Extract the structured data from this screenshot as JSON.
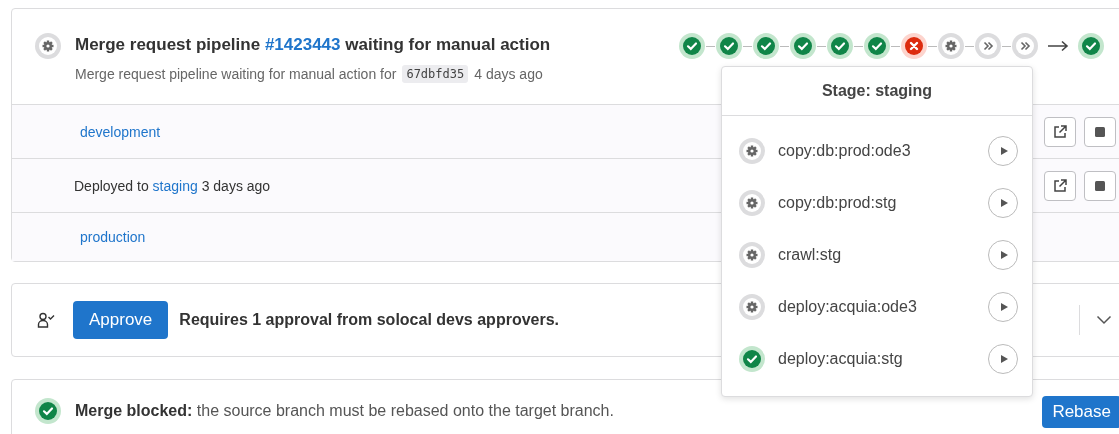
{
  "pipeline": {
    "kind": "manual",
    "title_prefix": "Merge request pipeline",
    "pipeline_link": "#1423443",
    "title_suffix": "waiting for manual action",
    "subtitle": "Merge request pipeline waiting for manual action for",
    "commit": "67dbfd35",
    "time": "4 days ago",
    "stages": [
      {
        "kind": "success"
      },
      {
        "kind": "success"
      },
      {
        "kind": "success"
      },
      {
        "kind": "success"
      },
      {
        "kind": "success"
      },
      {
        "kind": "success"
      },
      {
        "kind": "failed"
      },
      {
        "kind": "manual"
      },
      {
        "kind": "skipped"
      },
      {
        "kind": "skipped"
      }
    ],
    "downstream": {
      "kind": "success"
    }
  },
  "environments": [
    {
      "link": "development",
      "actions": true
    },
    {
      "prefix": "Deployed to",
      "link": "staging",
      "suffix": "3 days ago",
      "actions": true
    },
    {
      "link": "production",
      "actions": false
    }
  ],
  "approval": {
    "button": "Approve",
    "text": "Requires 1 approval from solocal devs approvers."
  },
  "merge": {
    "kind": "success",
    "bold": "Merge blocked:",
    "text": "the source branch must be rebased onto the target branch.",
    "button": "Rebase"
  },
  "dropdown": {
    "title": "Stage: staging",
    "jobs": [
      {
        "name": "copy:db:prod:ode3",
        "kind": "manual"
      },
      {
        "name": "copy:db:prod:stg",
        "kind": "manual"
      },
      {
        "name": "crawl:stg",
        "kind": "manual"
      },
      {
        "name": "deploy:acquia:ode3",
        "kind": "manual"
      },
      {
        "name": "deploy:acquia:stg",
        "kind": "success"
      }
    ]
  }
}
